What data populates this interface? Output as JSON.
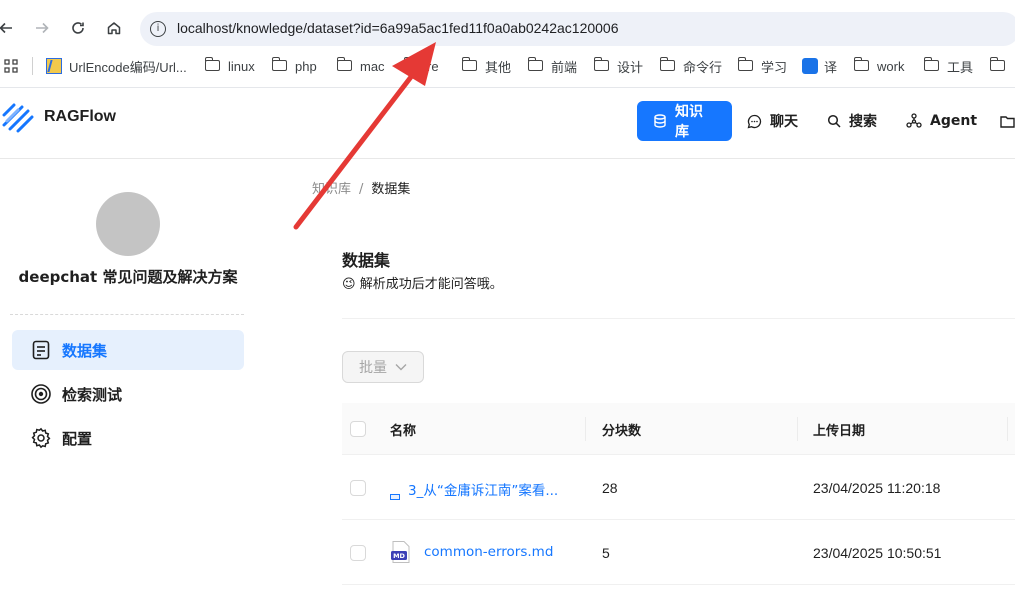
{
  "browser": {
    "url": "localhost/knowledge/dataset?id=6a99a5ac1fed11f0a0ab0242ac120006",
    "bookmarks": [
      "UrlEncode编码/Url...",
      "linux",
      "php",
      "mac",
      "re",
      "其他",
      "前端",
      "设计",
      "命令行",
      "学习",
      "译",
      "work",
      "工具"
    ]
  },
  "header": {
    "logo_text": "RAGFlow",
    "nav": [
      "知识库",
      "聊天",
      "搜索",
      "Agent"
    ]
  },
  "sidebar": {
    "kb_name": "deepchat 常见问题及解决方案",
    "items": [
      "数据集",
      "检索测试",
      "配置"
    ]
  },
  "main": {
    "breadcrumb": [
      "知识库",
      "数据集"
    ],
    "title": "数据集",
    "subtitle": "解析成功后才能问答哦。",
    "subtitle_emoji": "😉",
    "batch_label": "批量",
    "columns": [
      "名称",
      "分块数",
      "上传日期"
    ],
    "rows": [
      {
        "name": "3_从“金庸诉江南”案看...",
        "chunks": "28",
        "date": "23/04/2025 11:20:18"
      },
      {
        "name": "common-errors.md",
        "chunks": "5",
        "date": "23/04/2025 10:50:51"
      }
    ]
  },
  "colors": {
    "accent": "#1677ff",
    "arrow": "#e53935"
  }
}
